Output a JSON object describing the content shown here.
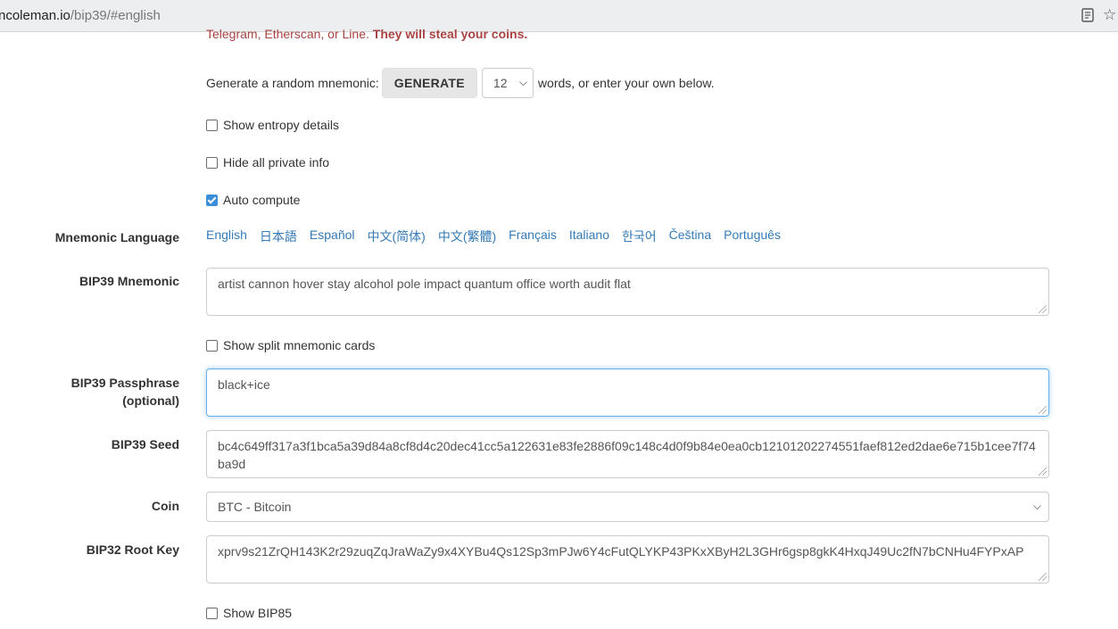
{
  "browser": {
    "url_host": "ncoleman.io",
    "url_path": "/bip39/#english"
  },
  "warning": {
    "text": "Telegram, Etherscan, or Line. ",
    "bold": "They will steal your coins."
  },
  "generate": {
    "prefix": "Generate a random mnemonic:",
    "button": "GENERATE",
    "words_value": "12",
    "suffix": "words, or enter your own below."
  },
  "options": {
    "entropy": {
      "label": "Show entropy details",
      "checked": false
    },
    "hide_private": {
      "label": "Hide all private info",
      "checked": false
    },
    "auto_compute": {
      "label": "Auto compute",
      "checked": true
    }
  },
  "mnemonic_language": {
    "label": "Mnemonic Language",
    "languages": [
      "English",
      "日本語",
      "Español",
      "中文(简体)",
      "中文(繁體)",
      "Français",
      "Italiano",
      "한국어",
      "Čeština",
      "Português"
    ]
  },
  "bip39_mnemonic": {
    "label": "BIP39 Mnemonic",
    "value": "artist cannon hover stay alcohol pole impact quantum office worth audit flat"
  },
  "split_cards": {
    "label": "Show split mnemonic cards",
    "checked": false
  },
  "passphrase": {
    "label_line1": "BIP39 Passphrase",
    "label_line2": "(optional)",
    "value": "black+ice"
  },
  "seed": {
    "label": "BIP39 Seed",
    "value": "bc4c649ff317a3f1bca5a39d84a8cf8d4c20dec41cc5a122631e83fe2886f09c148c4d0f9b84e0ea0cb12101202274551faef812ed2dae6e715b1cee7f74ba9d"
  },
  "coin": {
    "label": "Coin",
    "selected": "BTC - Bitcoin"
  },
  "root_key": {
    "label": "BIP32 Root Key",
    "value": "xprv9s21ZrQH143K2r29zuqZqJraWaZy9x4XYBu4Qs12Sp3mPJw6Y4cFutQLYKP43PKxXByH2L3GHr6gsp8gkK4HxqJ49Uc2fN7bCNHu4FYPxAP"
  },
  "bip85": {
    "label": "Show BIP85",
    "checked": false
  },
  "colors": {
    "link": "#337ab7",
    "warning": "#a94442",
    "checkbox_on": "#3b8fd9"
  }
}
